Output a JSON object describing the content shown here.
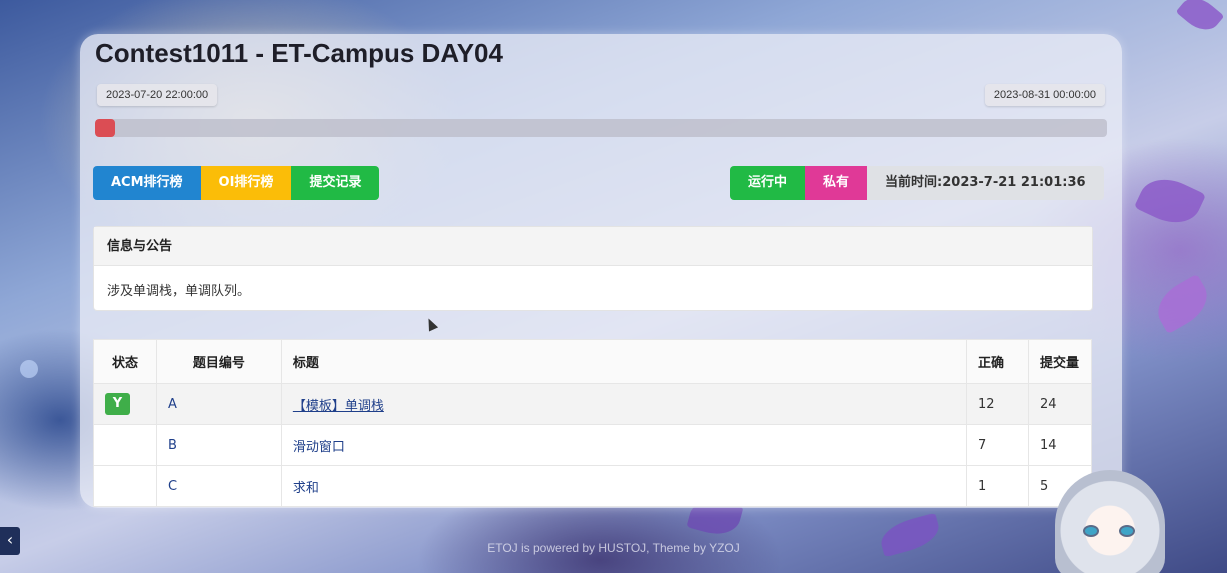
{
  "contest": {
    "title": "Contest1011 - ET-Campus DAY04",
    "start_time": "2023-07-20 22:00:00",
    "end_time": "2023-08-31 00:00:00",
    "progress_fraction": 0.02
  },
  "nav_buttons": {
    "acm_rank": "ACM排行榜",
    "oi_rank": "OI排行榜",
    "submissions": "提交记录"
  },
  "status_badges": {
    "running": "运行中",
    "private": "私有",
    "current_time": "当前时间:2023-7-21 21:01:36"
  },
  "info": {
    "heading": "信息与公告",
    "body": "涉及单调栈，单调队列。"
  },
  "table": {
    "headers": {
      "status": "状态",
      "problem_id": "题目编号",
      "title": "标题",
      "accepted": "正确",
      "submitted": "提交量"
    },
    "rows": [
      {
        "status": "Y",
        "id": "A",
        "title": "【模板】单调栈",
        "accepted": "12",
        "submitted": "24"
      },
      {
        "status": "",
        "id": "B",
        "title": "滑动窗口",
        "accepted": "7",
        "submitted": "14"
      },
      {
        "status": "",
        "id": "C",
        "title": "求和",
        "accepted": "1",
        "submitted": "5"
      }
    ]
  },
  "footer": "ETOJ is powered by HUSTOJ, Theme by YZOJ",
  "side_arrow": "‹",
  "colors": {
    "acm": "#2185d0",
    "oi": "#fbbd08",
    "submissions": "#21ba45",
    "running": "#21ba45",
    "private": "#e03997",
    "status_ok": "#3fae49",
    "progress_fill": "#db4d54"
  }
}
